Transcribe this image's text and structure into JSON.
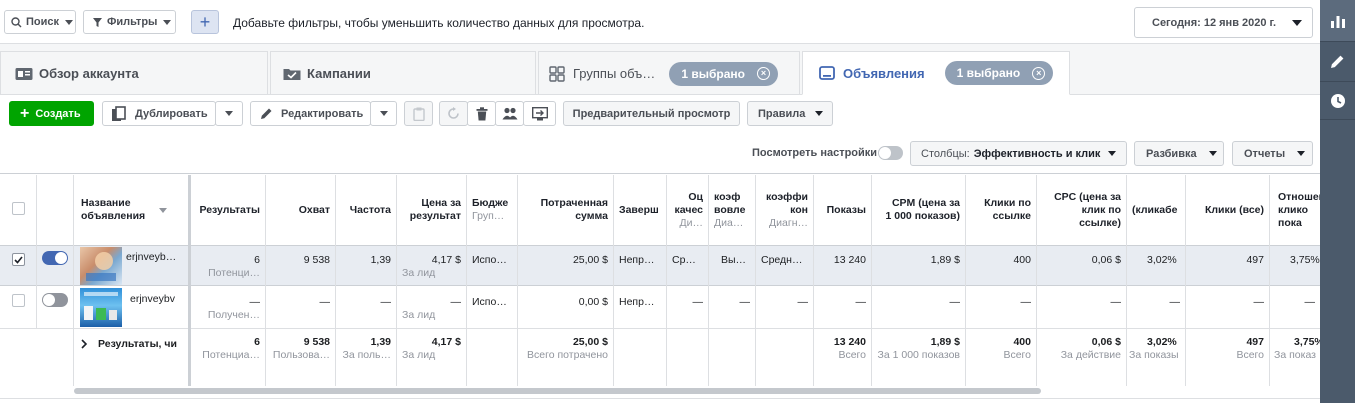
{
  "topbar": {
    "search_label": "Поиск",
    "filters_label": "Фильтры",
    "add_filter_hint": "Добавьте фильтры, чтобы уменьшить количество данных для просмотра.",
    "date_label": "Сегодня: 12 янв 2020 г."
  },
  "tabs": {
    "account": "Обзор аккаунта",
    "campaigns": "Кампании",
    "adsets": "Группы объ…",
    "adsets_badge": "1 выбрано",
    "ads": "Объявления",
    "ads_badge": "1 выбрано"
  },
  "toolbar": {
    "create": "Создать",
    "duplicate": "Дублировать",
    "edit": "Редактировать",
    "preview": "Предварительный просмотр",
    "rules": "Правила",
    "view_settings": "Посмотреть настройки",
    "columns_prefix": "Столбцы:",
    "columns_value": "Эффективность и клик",
    "breakdown": "Разбивка",
    "reports": "Отчеты"
  },
  "table": {
    "headers": {
      "name": "Название\nобъявления",
      "results": "Результаты",
      "reach": "Охват",
      "frequency": "Частота",
      "cost_per_result": "Цена за\nрезультат",
      "budget": "Бюдже",
      "budget_sub": "Груп…",
      "spent": "Потраченная\nсумма",
      "ends": "Заверш",
      "quality": "Оц\nкачес",
      "quality_sub": "Ди…",
      "engagement": "коэф\nвовле",
      "engagement_sub": "Диа…",
      "conversion": "коэффи\nкон",
      "conversion_sub": "Диагн…",
      "impressions": "Показы",
      "cpm": "CPM (цена за\n1 000 показов)",
      "link_clicks": "Клики по\nссылке",
      "cpc": "CPC (цена за\nклик по\nссылке)",
      "ctr": "(кликабе",
      "clicks_all": "Клики (все)",
      "ratio": "Отношен\nклико\nпока"
    },
    "rows": [
      {
        "name": "erjnveyb…",
        "results": "6",
        "results_sub": "Потенци…",
        "reach": "9 538",
        "frequency": "1,39",
        "cost_per_result": "4,17 $",
        "cost_sub": "За лид",
        "budget": "Испо…",
        "spent": "25,00 $",
        "ends": "Непр…",
        "quality": "Ср…",
        "engagement": "Вы…",
        "conversion": "Средн…",
        "impressions": "13 240",
        "cpm": "1,89 $",
        "link_clicks": "400",
        "cpc": "0,06 $",
        "ctr": "3,02%",
        "clicks_all": "497",
        "ratio": "3,75%"
      },
      {
        "name": "erjnveybv",
        "results": "—",
        "results_sub": "Получен…",
        "reach": "—",
        "frequency": "—",
        "cost_per_result": "—",
        "cost_sub": "За лид",
        "budget": "Испо…",
        "spent": "0,00 $",
        "ends": "Непр…",
        "quality": "—",
        "engagement": "—",
        "conversion": "—",
        "impressions": "—",
        "cpm": "—",
        "link_clicks": "—",
        "cpc": "—",
        "ctr": "—",
        "clicks_all": "—",
        "ratio": "—"
      }
    ],
    "totals": {
      "label": "Результаты, чи",
      "results": "6",
      "results_sub": "Потенциа…",
      "reach": "9 538",
      "reach_sub": "Пользова…",
      "frequency": "1,39",
      "frequency_sub": "За поль…",
      "cost_per_result": "4,17 $",
      "cost_sub": "За лид",
      "spent": "25,00 $",
      "spent_sub": "Всего потрачено",
      "impressions": "13 240",
      "impressions_sub": "Всего",
      "cpm": "1,89 $",
      "cpm_sub": "За 1 000 показов",
      "link_clicks": "400",
      "link_clicks_sub": "Всего",
      "cpc": "0,06 $",
      "cpc_sub": "За действие",
      "ctr": "3,02%",
      "ctr_sub": "За показы",
      "clicks_all": "497",
      "clicks_all_sub": "Всего",
      "ratio": "3,75%",
      "ratio_sub": "За показ"
    }
  },
  "colors": {
    "accent": "#4267b2",
    "create_green": "#00a400",
    "selected_row": "#e8ecf2",
    "sidebar": "#4b5a6b"
  },
  "sidebar_icons": [
    "bar-chart-icon",
    "pencil-icon",
    "clock-icon"
  ]
}
